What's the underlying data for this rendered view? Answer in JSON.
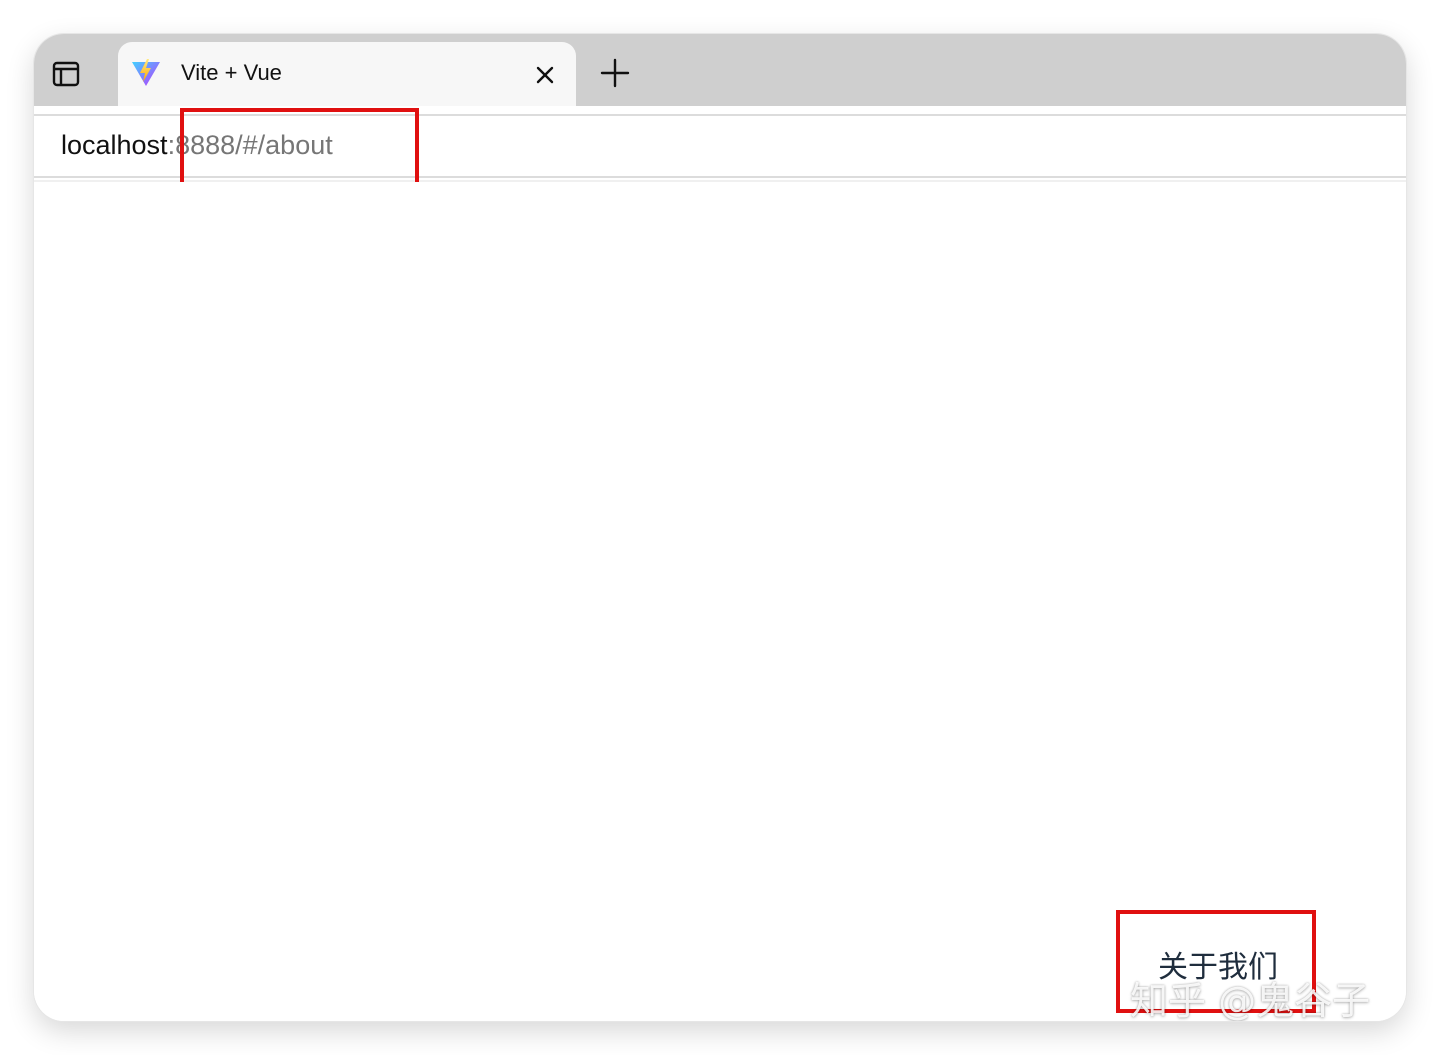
{
  "tab": {
    "title": "Vite + Vue",
    "favicon": "vite-logo-icon"
  },
  "toolbar": {
    "sidebar_icon": "sidebar-icon",
    "close_icon": "close-icon",
    "new_tab_icon": "plus-icon"
  },
  "address": {
    "host": "localhost",
    "rest": ":8888/#/about"
  },
  "page": {
    "about_label": "关于我们"
  },
  "watermark": {
    "text": "知乎 @鬼谷子"
  },
  "colors": {
    "highlight": "#e01010",
    "tabbar": "#cfcfcf",
    "active_tab": "#f7f7f7"
  }
}
